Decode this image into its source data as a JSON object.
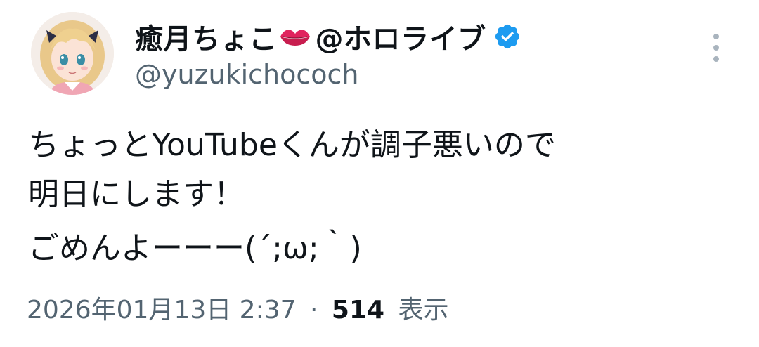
{
  "author": {
    "display_name": "癒月ちょこ",
    "affiliation": "@ホロライブ",
    "handle": "@yuzukichococh",
    "emoji_icon": "kiss-mark-icon",
    "verified_icon": "verified-badge-icon",
    "verified_color": "#1d9bf0"
  },
  "tweet": {
    "lines": [
      "ちょっとYouTubeくんが調子悪いので",
      "明日にします！",
      "ごめんよーーー(´;ω;｀)"
    ]
  },
  "meta": {
    "timestamp": "2026年01月13日 2:37",
    "separator": "·",
    "views_count": "514",
    "views_label": "表示"
  },
  "colors": {
    "text": "#0f1419",
    "secondary": "#536471",
    "lips": "#e0245e"
  }
}
